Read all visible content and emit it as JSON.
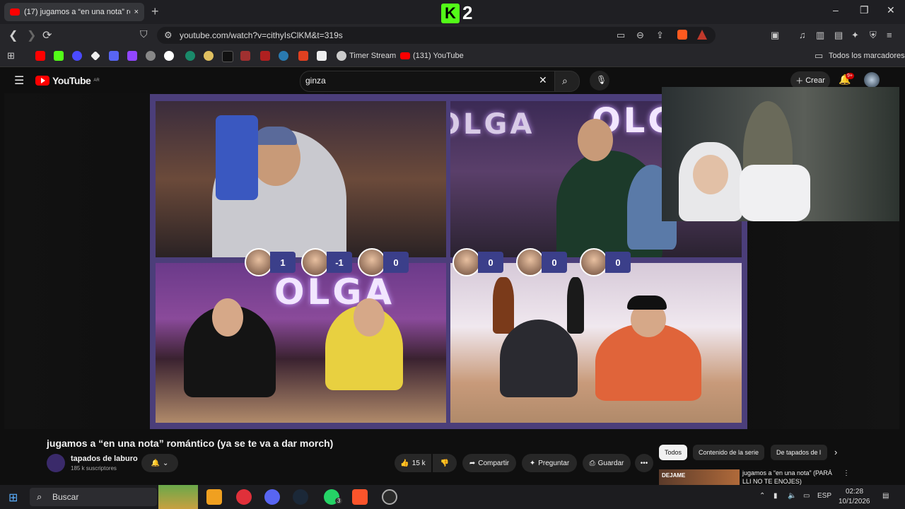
{
  "browser": {
    "tab_title": "(17) jugamos a “en una nota” ro",
    "tab_close": "×",
    "new_tab": "+",
    "k2_logo_letter": "K",
    "k2_logo_num": "2",
    "url": "youtube.com/watch?v=cithyIsClKM&t=319s",
    "win_min": "–",
    "win_max": "❐",
    "win_close": "✕",
    "bookmarks": [
      {
        "label": "Timer Stream"
      },
      {
        "label": "(131) YouTube"
      }
    ],
    "all_bookmarks": "Todos los marcadores"
  },
  "youtube": {
    "logo_text": "YouTube",
    "logo_sup": "AR",
    "search_value": "ginza",
    "create_label": "Crear",
    "notif_badge": "9+"
  },
  "video": {
    "olga_text": "OLGA",
    "scores_left": [
      "1",
      "-1",
      "0"
    ],
    "scores_right": [
      "0",
      "0",
      "0"
    ],
    "title": "jugamos a “en una nota” romántico (ya se te va a dar morch)",
    "channel": "tapados de laburo",
    "subscribers": "185 k suscriptores",
    "likes": "15 k",
    "share": "Compartir",
    "ask": "Preguntar",
    "save": "Guardar",
    "more": "•••"
  },
  "sidebar": {
    "chips": [
      "Todos",
      "Contenido de la serie",
      "De tapados de l"
    ],
    "rec_title": "jugamos a “en una nota” (PARÁ",
    "rec_title2": "LLI NO TE ENOJES)",
    "rec_thumb_text": "DEJAME"
  },
  "taskbar": {
    "search_placeholder": "Buscar",
    "lang": "ESP",
    "time": "02:28",
    "date": "10/1/2026",
    "whatsapp_badge": "3"
  }
}
